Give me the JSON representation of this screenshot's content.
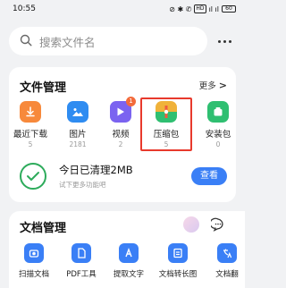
{
  "status_bar": {
    "time": "10:55",
    "icons_text": "⊘ ✱ ✆",
    "hd_label": "HD",
    "signal": "ıl ıl",
    "battery": "60"
  },
  "search": {
    "placeholder": "搜索文件名"
  },
  "file_management": {
    "title": "文件管理",
    "more_label": "更多",
    "more_chevron": ">",
    "items": [
      {
        "label": "最近下载",
        "count": "5",
        "color": "#f7893b",
        "icon": "download-icon"
      },
      {
        "label": "图片",
        "count": "2181",
        "color": "#2f8cf1",
        "icon": "image-icon"
      },
      {
        "label": "视频",
        "count": "2",
        "color": "#7b63f0",
        "icon": "video-icon",
        "badge": "1"
      },
      {
        "label": "压缩包",
        "count": "5",
        "color": "#ef5b3f",
        "icon": "archive-icon"
      },
      {
        "label": "安装包",
        "count": "0",
        "color": "#2fbf71",
        "icon": "package-icon"
      }
    ],
    "clean": {
      "title": "今日已清理2MB",
      "subtitle": "试下更多功能吧",
      "button": "查看"
    }
  },
  "doc_management": {
    "title": "文档管理",
    "items": [
      {
        "label": "扫描文档",
        "icon": "scan-icon"
      },
      {
        "label": "PDF工具",
        "icon": "pdf-icon"
      },
      {
        "label": "提取文字",
        "icon": "text-extract-icon"
      },
      {
        "label": "文档转长图",
        "icon": "doc-to-image-icon"
      },
      {
        "label": "文档翻",
        "icon": "translate-icon"
      }
    ]
  },
  "colors": {
    "accent": "#3a7ff6",
    "highlight": "#e8392c",
    "clean_green": "#2dab5b"
  }
}
